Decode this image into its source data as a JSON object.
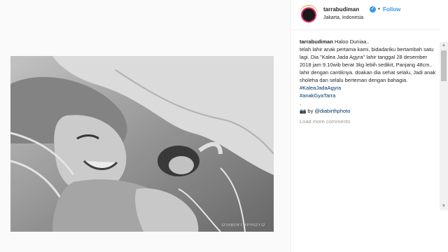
{
  "header": {
    "username": "tarrabudiman",
    "follow_label": "Follow",
    "separator": "•",
    "location": "Jakarta, Indonesia"
  },
  "caption": {
    "username": "tarrabudiman",
    "first_line": "Haloo Duniaa..",
    "body": "telah lahir anak pertama kami, bidadariku bertambah satu lagi. Dia \"Kalea Jada Agyra\" lahir tanggal 28 desember 2018 jam 9.10wib berat 3kg lebih sedikit, Panjang 48cm.. lahir dengan cantiknya. doakan dia sehat selalu, Jadi anak sholeha dan selalu berteman dengan bahagia.",
    "hashtags": [
      "#KaleaJadaAgyra",
      "#anakGyaTarra"
    ],
    "dot_line": ".",
    "credit_prefix": "📷 by ",
    "credit_handle": "@diabirthphoto"
  },
  "load_more_label": "Load more comments",
  "photo": {
    "watermark": "DIABIRTHPHOTO"
  },
  "colors": {
    "link": "#3897f0",
    "hashtag": "#003569",
    "muted": "#999999"
  },
  "icons": {
    "verified": "verified-badge-icon",
    "avatar": "profile-avatar"
  }
}
